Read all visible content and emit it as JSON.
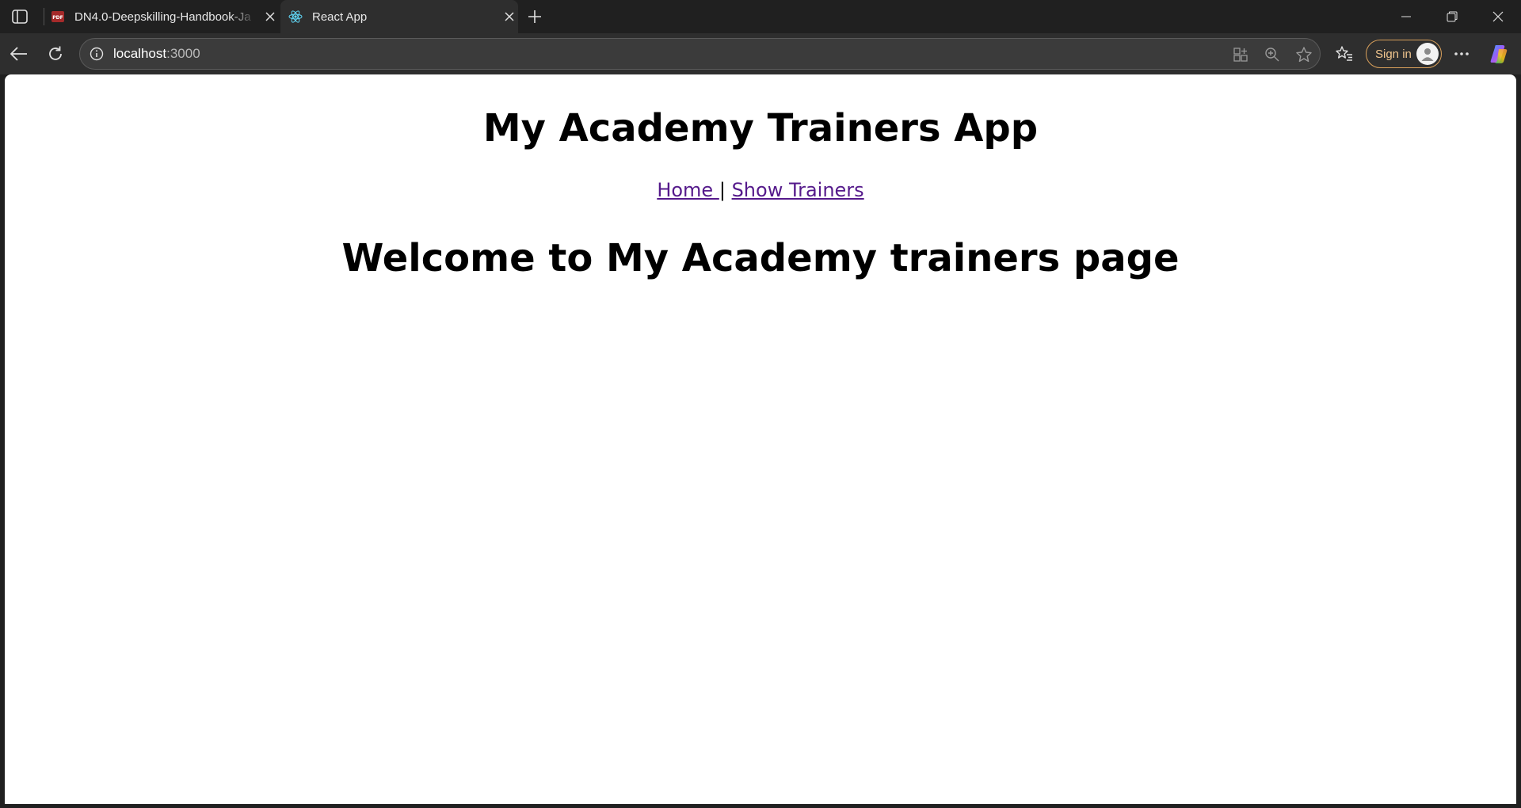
{
  "browser": {
    "tabs": [
      {
        "title": "DN4.0-Deepskilling-Handbook-Ja",
        "icon": "pdf-icon",
        "active": false
      },
      {
        "title": "React App",
        "icon": "react-icon",
        "active": true
      }
    ],
    "address": {
      "host": "localhost",
      "port": ":3000"
    },
    "signin_label": "Sign in"
  },
  "page": {
    "heading": "My Academy Trainers App",
    "nav": {
      "home": "Home ",
      "separator": "|",
      "show_trainers": "Show Trainers"
    },
    "welcome": "Welcome to My Academy trainers page"
  },
  "colors": {
    "link_visited": "#551a8b",
    "signin_accent": "#d9a05b"
  }
}
